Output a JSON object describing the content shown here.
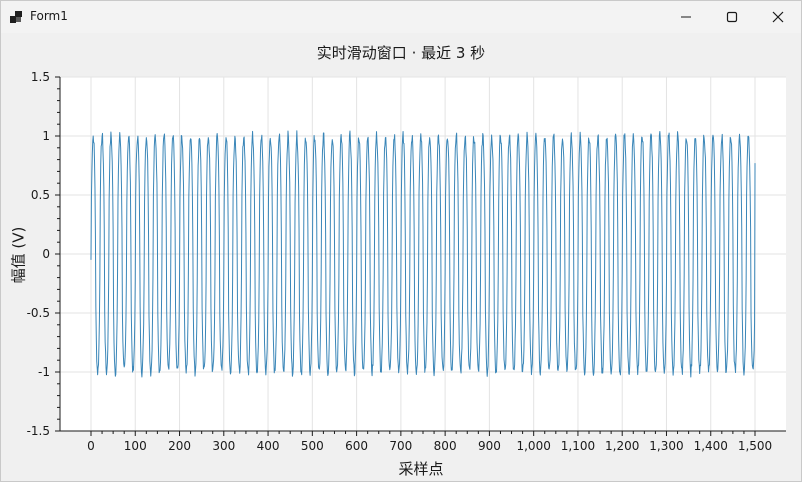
{
  "window": {
    "title": "Form1",
    "controls": {
      "minimize": "minimize",
      "maximize": "maximize",
      "close": "close"
    }
  },
  "chart_data": {
    "type": "line",
    "title": "实时滑动窗口 · 最近 3 秒",
    "xlabel": "采样点",
    "ylabel": "幅值 (V)",
    "xlim": [
      -70,
      1570
    ],
    "ylim": [
      -1.5,
      1.5
    ],
    "x_ticks": [
      0,
      100,
      200,
      300,
      400,
      500,
      600,
      700,
      800,
      900,
      1000,
      1100,
      1200,
      1300,
      1400,
      1500
    ],
    "x_tick_labels": [
      "0",
      "100",
      "200",
      "300",
      "400",
      "500",
      "600",
      "700",
      "800",
      "900",
      "1,000",
      "1,100",
      "1,200",
      "1,300",
      "1,400",
      "1,500"
    ],
    "y_ticks": [
      -1.5,
      -1,
      -0.5,
      0,
      0.5,
      1,
      1.5
    ],
    "y_tick_labels": [
      "-1.5",
      "-1",
      "-0.5",
      "0",
      "0.5",
      "1",
      "1.5"
    ],
    "grid": true,
    "series": [
      {
        "color": "#3a86b8",
        "x_start": 0,
        "x_end": 1500,
        "samples": 1500,
        "cycles": 75,
        "amplitude": 1.0,
        "start_value": -0.05,
        "end_value": 0.77
      }
    ]
  }
}
